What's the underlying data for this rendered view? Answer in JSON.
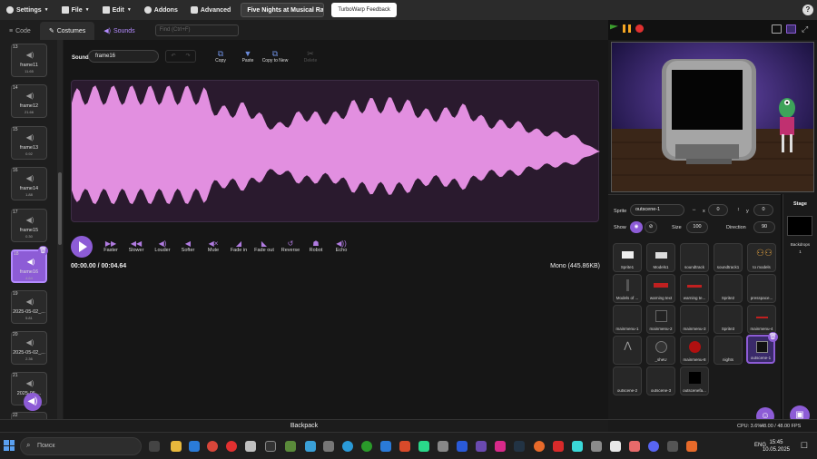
{
  "menubar": {
    "settings": "Settings",
    "file": "File",
    "edit": "Edit",
    "addons": "Addons",
    "advanced": "Advanced",
    "project_title": "Five Nights at Musical Rar...",
    "feedback": "TurboWarp Feedback"
  },
  "tabs": {
    "code": "Code",
    "costumes": "Costumes",
    "sounds": "Sounds",
    "find_placeholder": "Find (Ctrl+F)"
  },
  "costumes": [
    {
      "num": "13",
      "name": "frame11",
      "dur": "11.65"
    },
    {
      "num": "14",
      "name": "frame12",
      "dur": "21.66"
    },
    {
      "num": "15",
      "name": "frame13",
      "dur": "0.92"
    },
    {
      "num": "16",
      "name": "frame14",
      "dur": "1.88"
    },
    {
      "num": "17",
      "name": "frame15",
      "dur": "0.30"
    },
    {
      "num": "18",
      "name": "frame16",
      "dur": "4.64"
    },
    {
      "num": "19",
      "name": "2025-05-02_...",
      "dur": "5.81"
    },
    {
      "num": "20",
      "name": "2025-05-02_...",
      "dur": "2.36"
    },
    {
      "num": "21",
      "name": "2025-05-...",
      "dur": ""
    },
    {
      "num": "22",
      "name": "",
      "dur": ""
    }
  ],
  "editor": {
    "sound_label": "Sound",
    "sound_name": "frame16",
    "tools": [
      "Copy",
      "Paste",
      "Copy to New",
      "Delete"
    ],
    "effects": [
      "Faster",
      "Slower",
      "Louder",
      "Softer",
      "Mute",
      "Fade in",
      "Fade out",
      "Reverse",
      "Robot",
      "Echo"
    ],
    "time": "00:00.00 / 00:04.64",
    "format": "Mono (445.86KB)"
  },
  "sprite_info": {
    "sprite_label": "Sprite",
    "sprite_name": "outscene-1",
    "x_label": "x",
    "x_value": "0",
    "y_label": "y",
    "y_value": "0",
    "show_label": "Show",
    "size_label": "Size",
    "size_value": "100",
    "direction_label": "Direction",
    "direction_value": "90"
  },
  "sprites": [
    "Sprite1",
    "Models1",
    "soundtrack",
    "soundtrack1",
    "to models",
    "Models of ...",
    "warning text",
    "warning te...",
    "Sprite2",
    "presspace...",
    "mainmenu-1",
    "mainmenu-2",
    "mainmenu-3",
    "Sprite3",
    "mainmenu-4",
    "",
    "_sheU",
    "mainmenu-8",
    "nights",
    "outscene-1",
    "outscene-2",
    "outscene-3",
    "outscenefa..."
  ],
  "stage_panel": {
    "title": "Stage",
    "backdrops_label": "Backdrops",
    "backdrops_count": "1"
  },
  "backpack": "Backpack",
  "status": {
    "cpu": "CPU: 3.6%",
    "fps": "48.00 / 48.00 FPS"
  },
  "taskbar": {
    "search": "Поиск",
    "lang": "ENG",
    "time": "15:45",
    "date": "10.05.2025"
  },
  "colors": {
    "accent": "#8d5cd6",
    "waveform": "#e28fe0",
    "wave_bg": "#2a1a2e"
  }
}
